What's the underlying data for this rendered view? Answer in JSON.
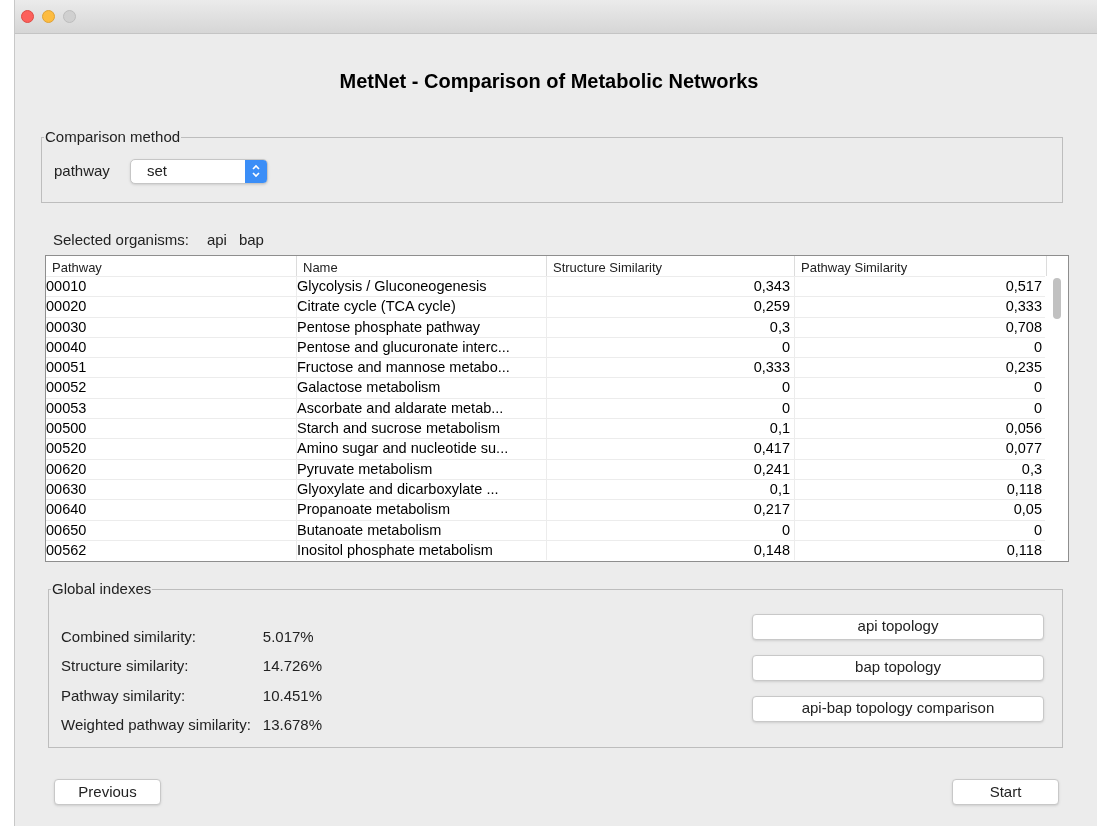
{
  "heading": "MetNet - Comparison of Metabolic Networks",
  "comparison_method": {
    "legend": "Comparison method",
    "label": "pathway",
    "value": "set"
  },
  "selected_organisms": {
    "label": "Selected organisms:",
    "organisms": [
      "api",
      "bap"
    ]
  },
  "table": {
    "columns": [
      "Pathway",
      "Name",
      "Structure Similarity",
      "Pathway Similarity"
    ],
    "rows": [
      [
        "00010",
        "Glycolysis / Gluconeogenesis",
        "0,343",
        "0,517"
      ],
      [
        "00020",
        "Citrate cycle (TCA cycle)",
        "0,259",
        "0,333"
      ],
      [
        "00030",
        "Pentose phosphate pathway",
        "0,3",
        "0,708"
      ],
      [
        "00040",
        "Pentose and glucuronate interc...",
        "0",
        "0"
      ],
      [
        "00051",
        "Fructose and mannose metabo...",
        "0,333",
        "0,235"
      ],
      [
        "00052",
        "Galactose metabolism",
        "0",
        "0"
      ],
      [
        "00053",
        "Ascorbate and aldarate metab...",
        "0",
        "0"
      ],
      [
        "00500",
        "Starch and sucrose metabolism",
        "0,1",
        "0,056"
      ],
      [
        "00520",
        "Amino sugar and nucleotide su...",
        "0,417",
        "0,077"
      ],
      [
        "00620",
        "Pyruvate metabolism",
        "0,241",
        "0,3"
      ],
      [
        "00630",
        "Glyoxylate and dicarboxylate ...",
        "0,1",
        "0,118"
      ],
      [
        "00640",
        "Propanoate metabolism",
        "0,217",
        "0,05"
      ],
      [
        "00650",
        "Butanoate metabolism",
        "0",
        "0"
      ],
      [
        "00562",
        "Inositol phosphate metabolism",
        "0,148",
        "0,118"
      ]
    ]
  },
  "global_indexes": {
    "legend": "Global indexes",
    "metrics": [
      {
        "label": "Combined similarity:",
        "value": "5.017%"
      },
      {
        "label": "Structure similarity:",
        "value": "14.726%"
      },
      {
        "label": "Pathway similarity:",
        "value": "10.451%"
      },
      {
        "label": "Weighted pathway similarity:",
        "value": "13.678%"
      }
    ],
    "buttons": [
      "api topology",
      "bap topology",
      "api-bap topology comparison"
    ]
  },
  "footer_buttons": [
    "Previous",
    "Start"
  ]
}
